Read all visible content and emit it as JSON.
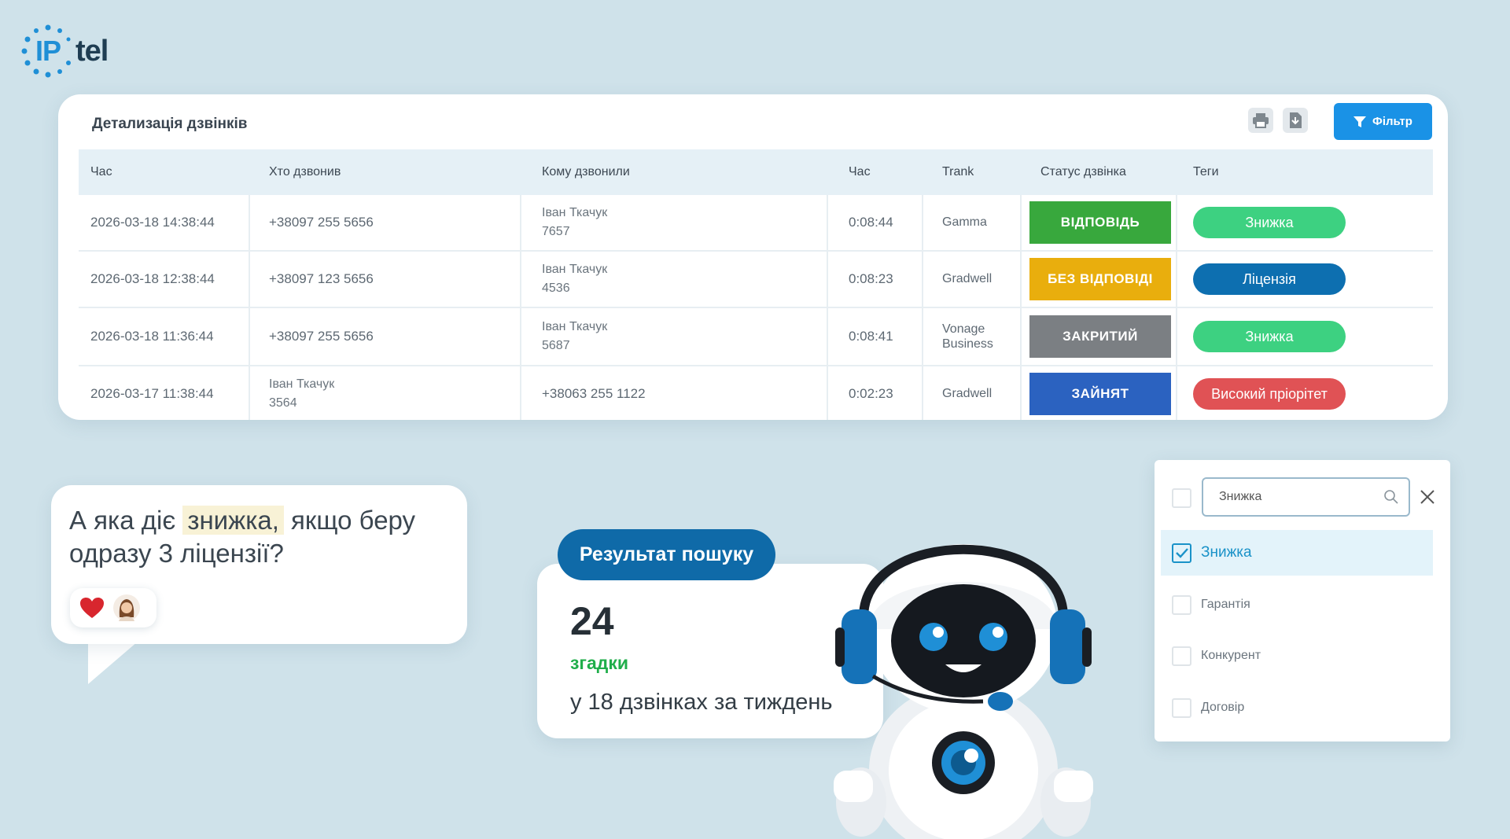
{
  "logo": {
    "ip": "IP",
    "tel": "tel"
  },
  "calls": {
    "title": "Детализація дзвінків",
    "filter_label": "Фільтр",
    "columns": [
      "Час",
      "Хто дзвонив",
      "Кому дзвонили",
      "Час",
      "Trank",
      "Статус дзвінка",
      "Теги"
    ],
    "rows": [
      {
        "time": "2026-03-18 14:38:44",
        "caller": "+38097 255 5656",
        "callee_name": "Іван Ткачук",
        "callee_ext": "7657",
        "duration": "0:08:44",
        "trunk": "Gamma",
        "trunk2": "",
        "status": "ВІДПОВІДЬ",
        "status_color": "#38a83d",
        "tag": "Знижка",
        "tag_color": "#3dd181"
      },
      {
        "time": "2026-03-18 12:38:44",
        "caller": "+38097 123 5656",
        "callee_name": "Іван Ткачук",
        "callee_ext": "4536",
        "duration": "0:08:23",
        "trunk": "Gradwell",
        "trunk2": "",
        "status": "БЕЗ ВІДПОВІДІ",
        "status_color": "#e9ae0d",
        "tag": "Ліцензія",
        "tag_color": "#0d6fb0"
      },
      {
        "time": "2026-03-18 11:36:44",
        "caller": "+38097 255 5656",
        "callee_name": "Іван Ткачук",
        "callee_ext": "5687",
        "duration": "0:08:41",
        "trunk": "Vonage",
        "trunk2": "Business",
        "status": "ЗАКРИТИЙ",
        "status_color": "#7b7f83",
        "tag": "Знижка",
        "tag_color": "#3dd181"
      },
      {
        "time": "2026-03-17 11:38:44",
        "caller_name": "Іван Ткачук",
        "caller_ext": "3564",
        "callee": "+38063 255 1122",
        "duration": "0:02:23",
        "trunk": "Gradwell",
        "trunk2": "",
        "status": "ЗАЙНЯТ",
        "status_color": "#2b62c0",
        "tag": "Високий пріорітет",
        "tag_color": "#e05255"
      }
    ]
  },
  "chat": {
    "before": "А яка діє ",
    "highlight": "знижка,",
    "after": " якщо беру одразу 3 ліцензії?",
    "reaction_icon": "heart-icon"
  },
  "result": {
    "pill": "Результат пошуку",
    "count": "24",
    "label": "згадки",
    "desc": "у 18 дзвінках за тиждень"
  },
  "dropdown": {
    "search_value": "Знижка",
    "options": [
      {
        "label": "Знижка",
        "checked": true
      },
      {
        "label": "Гарантія",
        "checked": false
      },
      {
        "label": "Конкурент",
        "checked": false
      },
      {
        "label": "Договір",
        "checked": false
      }
    ]
  },
  "colors": {
    "background": "#cfe2ea",
    "accent": "#1a92e6",
    "pill": "#0f6aa8"
  }
}
